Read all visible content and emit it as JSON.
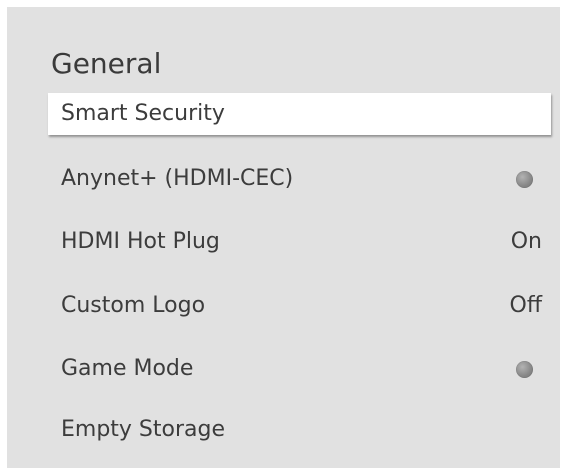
{
  "menu": {
    "title": "General",
    "items": [
      {
        "label": "Smart Security"
      },
      {
        "label": "Anynet+ (HDMI-CEC)",
        "toggle_state": "off"
      },
      {
        "label": "HDMI Hot Plug",
        "value": "On"
      },
      {
        "label": "Custom Logo",
        "value": "Off"
      },
      {
        "label": "Game Mode",
        "toggle_state": "off"
      },
      {
        "label": "Empty Storage"
      }
    ]
  },
  "colors": {
    "panel_background": "#e1e1e1",
    "selected_background": "#ffffff",
    "text": "#3c3c3c",
    "toggle_off": "#8a8a8a"
  }
}
